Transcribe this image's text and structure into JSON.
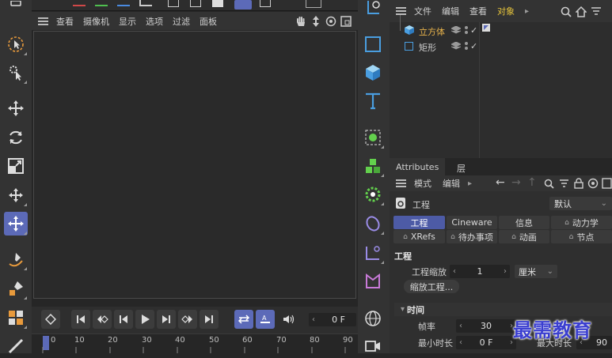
{
  "viewport_menu": {
    "items": [
      "查看",
      "摄像机",
      "显示",
      "选项",
      "过滤",
      "面板"
    ]
  },
  "object_manager": {
    "menu": [
      "文件",
      "编辑",
      "查看",
      "对象"
    ],
    "objects": [
      {
        "name": "立方体",
        "selected": true
      },
      {
        "name": "矩形",
        "selected": false
      }
    ]
  },
  "attributes": {
    "tabs": [
      "Attributes",
      "层"
    ],
    "menu": [
      "模式",
      "编辑"
    ],
    "mode_label": "工程",
    "preset": "默认",
    "subtabs_row1": [
      "工程",
      "Cineware",
      "信息",
      "动力学"
    ],
    "subtabs_row2": [
      "XRefs",
      "待办事项",
      "动画",
      "节点"
    ],
    "section_title": "工程",
    "scale_label": "工程缩放",
    "scale_value": "1",
    "scale_unit": "厘米",
    "scale_button": "缩放工程...",
    "time_section": "时间",
    "fps_label": "帧率",
    "fps_value": "30",
    "min_time_label": "最小时长",
    "min_time_value": "0 F",
    "max_time_label": "最大时长",
    "max_time_value": "90"
  },
  "timeline": {
    "current_frame": "0 F",
    "ruler_labels": [
      "0",
      "10",
      "20",
      "30",
      "40",
      "50",
      "60",
      "70",
      "80",
      "90"
    ]
  },
  "watermark": "最需教育",
  "colors": {
    "accent": "#5c6ab8",
    "active_object": "#e8b34b",
    "panel": "#333333"
  }
}
